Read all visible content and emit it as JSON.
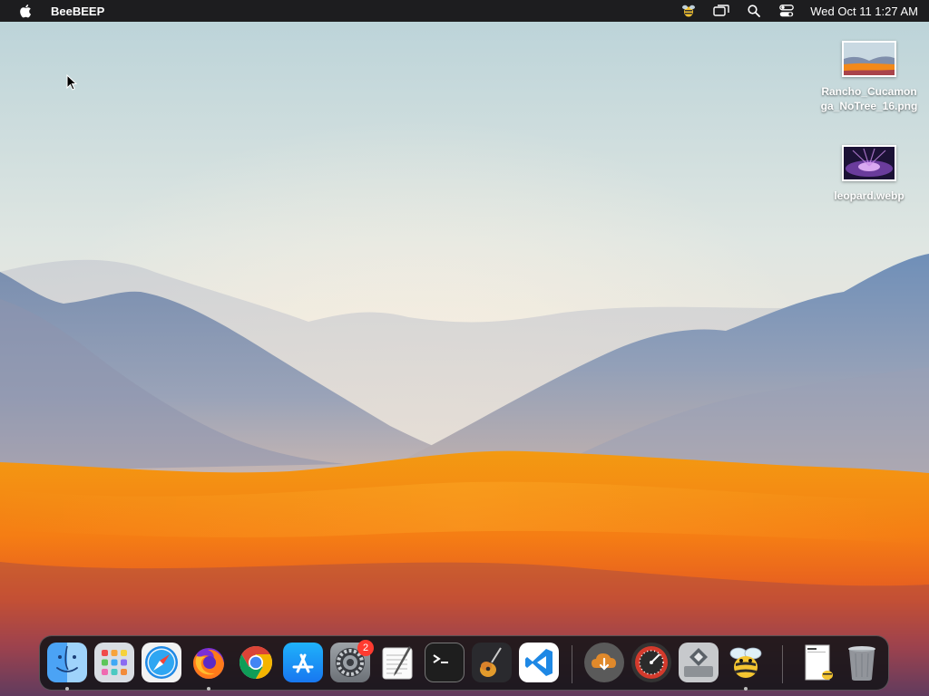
{
  "menubar": {
    "app_name": "BeeBEEP",
    "clock": "Wed Oct 11  1:27 AM",
    "icons": [
      "apple-icon",
      "beebeep-status-icon",
      "screen-mirroring-icon",
      "spotlight-search-icon",
      "control-center-icon"
    ]
  },
  "desktop": {
    "files": [
      {
        "name": "Rancho_Cucamonga_NoTree_16.png",
        "line1": "Rancho_Cucamon",
        "line2": "ga_NoTree_16.png"
      },
      {
        "name": "leopard.webp",
        "line1": "leopard.webp",
        "line2": ""
      }
    ]
  },
  "dock": {
    "apps": [
      {
        "name": "Finder",
        "running": true
      },
      {
        "name": "Launchpad",
        "running": false
      },
      {
        "name": "Safari",
        "running": false
      },
      {
        "name": "Firefox",
        "running": true
      },
      {
        "name": "Google Chrome",
        "running": false
      },
      {
        "name": "App Store",
        "running": false
      },
      {
        "name": "System Settings",
        "running": false,
        "badge": "2"
      },
      {
        "name": "TextEdit",
        "running": false
      },
      {
        "name": "Terminal",
        "running": false
      },
      {
        "name": "GarageBand",
        "running": false
      },
      {
        "name": "Visual Studio Code",
        "running": false
      },
      {
        "name": "Downloader",
        "running": false
      },
      {
        "name": "Disk Diag",
        "running": false
      },
      {
        "name": "Boot Camp Assistant",
        "running": false
      },
      {
        "name": "BeeBEEP",
        "running": true
      },
      {
        "name": "Preview Document",
        "running": false
      },
      {
        "name": "Trash",
        "running": false
      }
    ]
  }
}
